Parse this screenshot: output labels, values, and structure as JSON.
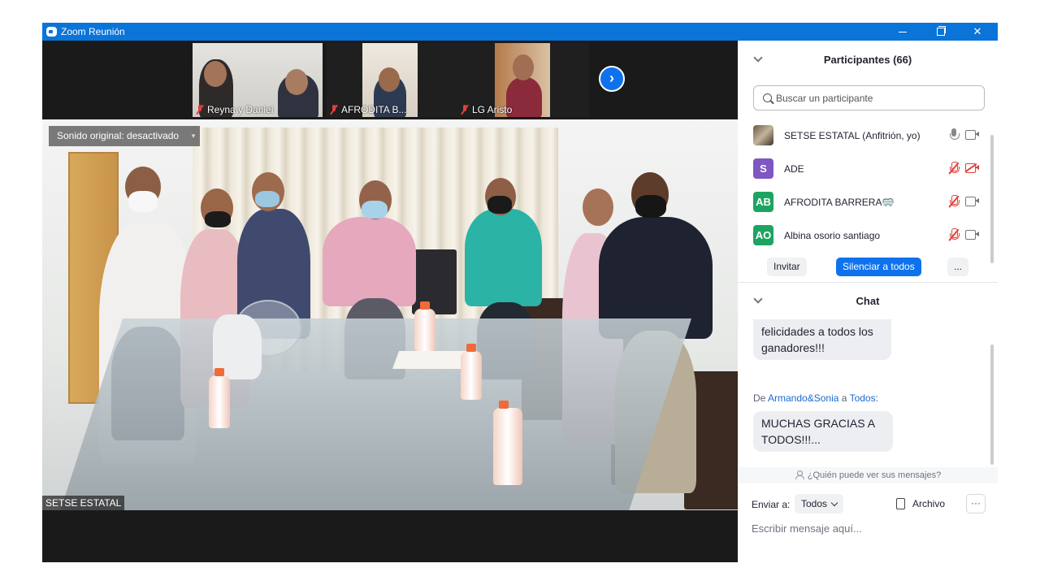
{
  "window": {
    "title": "Zoom Reunión",
    "minimize_icon": "minimize-icon",
    "maximize_icon": "restore-icon",
    "close_label": "✕"
  },
  "video": {
    "thumbnails": [
      {
        "name": "Reyna y Daniel",
        "muted": true
      },
      {
        "name": "AFRODITA  B...",
        "muted": true
      },
      {
        "name": "LG Aristo",
        "muted": true
      }
    ],
    "next_icon": "chevron-right-icon",
    "next_label": "›",
    "sound_label": "Sonido original: desactivado",
    "sound_dropdown": "▾",
    "main_name": "SETSE ESTATAL"
  },
  "participants": {
    "title": "Participantes (66)",
    "search_placeholder": "Buscar un participante",
    "list": [
      {
        "avatar": "",
        "avatar_color": "#6b5a4a",
        "name": "SETSE ESTATAL (Anfitrión, yo)",
        "mic_muted": false,
        "cam_muted": false
      },
      {
        "avatar": "S",
        "avatar_color": "#7e57c2",
        "name": "ADE",
        "mic_muted": true,
        "cam_muted": true
      },
      {
        "avatar": "AB",
        "avatar_color": "#1da462",
        "name": "AFRODITA  BARRERA🥽",
        "mic_muted": true,
        "cam_muted": false
      },
      {
        "avatar": "AO",
        "avatar_color": "#1da462",
        "name": "Albina osorio santiago",
        "mic_muted": true,
        "cam_muted": false
      }
    ],
    "invite_label": "Invitar",
    "mute_all_label": "Silenciar a todos",
    "more_label": "..."
  },
  "chat": {
    "title": "Chat",
    "messages": [
      {
        "text": "felicidades a todos los ganadores!!!"
      },
      {
        "from_prefix": "De",
        "from": "Armando&Sonia",
        "to_prefix": "a",
        "to": "Todos:",
        "text": "MUCHAS GRACIAS A TODOS!!!..."
      }
    ],
    "who_sees": "¿Quién puede ver sus mensajes?",
    "send_to_label": "Enviar a:",
    "send_to_value": "Todos",
    "file_label": "Archivo",
    "more_label": "···",
    "input_placeholder": "Escribir mensaje aquí..."
  },
  "colors": {
    "accent": "#0e72ed",
    "titlebar": "#0b74d9",
    "muted": "#e0413a"
  }
}
